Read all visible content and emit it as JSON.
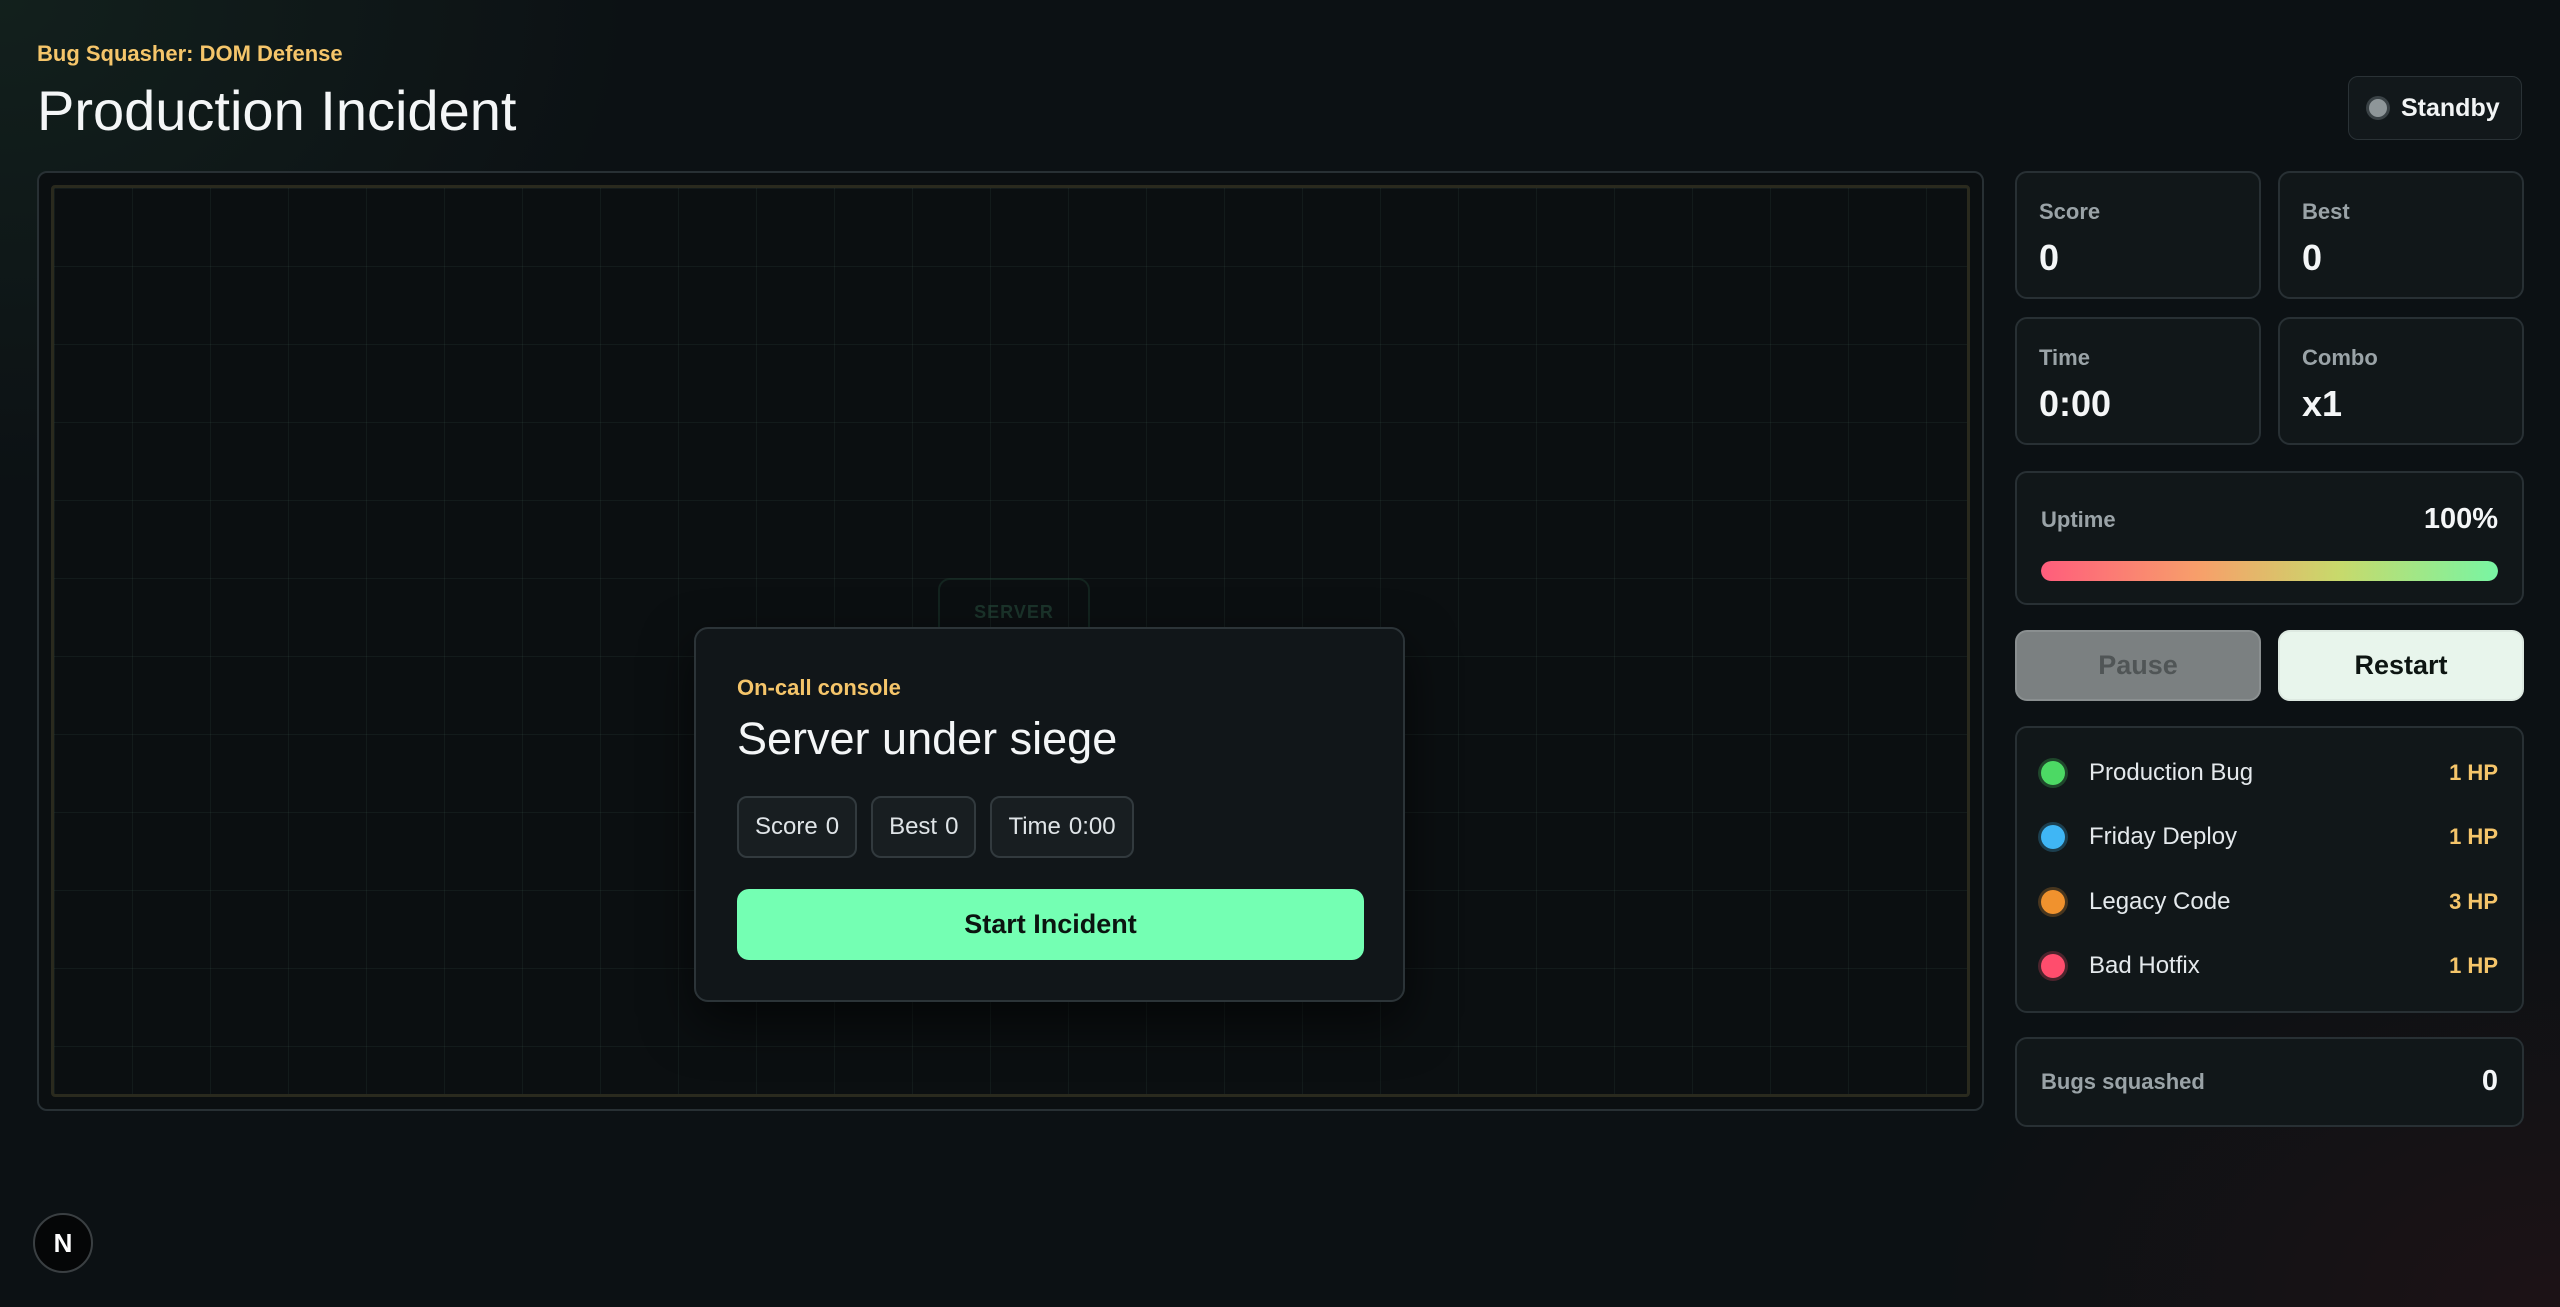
{
  "header": {
    "eyebrow": "Bug Squasher: DOM Defense",
    "title": "Production Incident",
    "status": "Standby"
  },
  "arena": {
    "server_label": "SERVER",
    "console": {
      "eyebrow": "On-call console",
      "title": "Server under siege",
      "chips": [
        {
          "label": "Score",
          "value": "0"
        },
        {
          "label": "Best",
          "value": "0"
        },
        {
          "label": "Time",
          "value": "0:00"
        }
      ],
      "start_label": "Start Incident"
    }
  },
  "stats": {
    "score": {
      "label": "Score",
      "value": "0"
    },
    "best": {
      "label": "Best",
      "value": "0"
    },
    "time": {
      "label": "Time",
      "value": "0:00"
    },
    "combo": {
      "label": "Combo",
      "value": "x1"
    }
  },
  "uptime": {
    "label": "Uptime",
    "value": "100%",
    "fraction": 1.0
  },
  "controls": {
    "pause_label": "Pause",
    "restart_label": "Restart"
  },
  "legend": [
    {
      "name": "Production Bug",
      "hp": "1 HP",
      "color": "#4cd964"
    },
    {
      "name": "Friday Deploy",
      "hp": "1 HP",
      "color": "#3fb6f5"
    },
    {
      "name": "Legacy Code",
      "hp": "3 HP",
      "color": "#f0922e"
    },
    {
      "name": "Bad Hotfix",
      "hp": "1 HP",
      "color": "#ff4d6d"
    }
  ],
  "squashed": {
    "label": "Bugs squashed",
    "value": "0"
  },
  "badge": {
    "letter": "N"
  },
  "colors": {
    "accent": "#74ffb3",
    "eyebrow": "#f5c56a"
  }
}
